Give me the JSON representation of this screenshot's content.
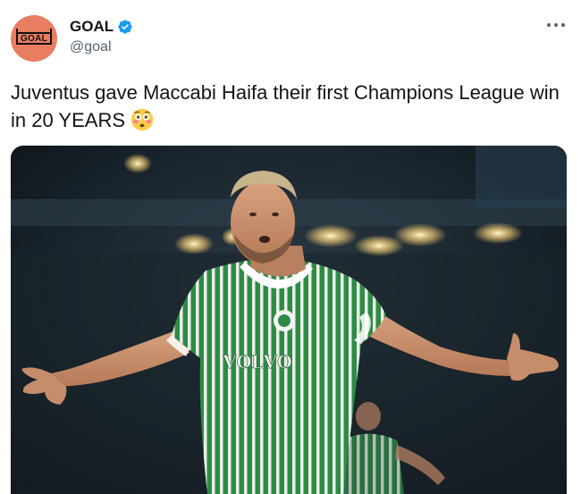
{
  "account": {
    "display_name": "GOAL",
    "handle": "@goal",
    "avatar_text": "GOAL",
    "avatar_color": "#e87d62",
    "verified": true,
    "verified_color": "#1d9bf0"
  },
  "tweet": {
    "text": "Juventus gave Maccabi Haifa their first Champions League win in 20 YEARS",
    "emoji": "flushed-face"
  },
  "media": {
    "sponsor_text": "VOLVO",
    "jersey_colors": [
      "#2e8b46",
      "#e9efe6"
    ]
  },
  "icons": {
    "more": "more-dots-icon",
    "verified": "verified-badge-icon"
  }
}
